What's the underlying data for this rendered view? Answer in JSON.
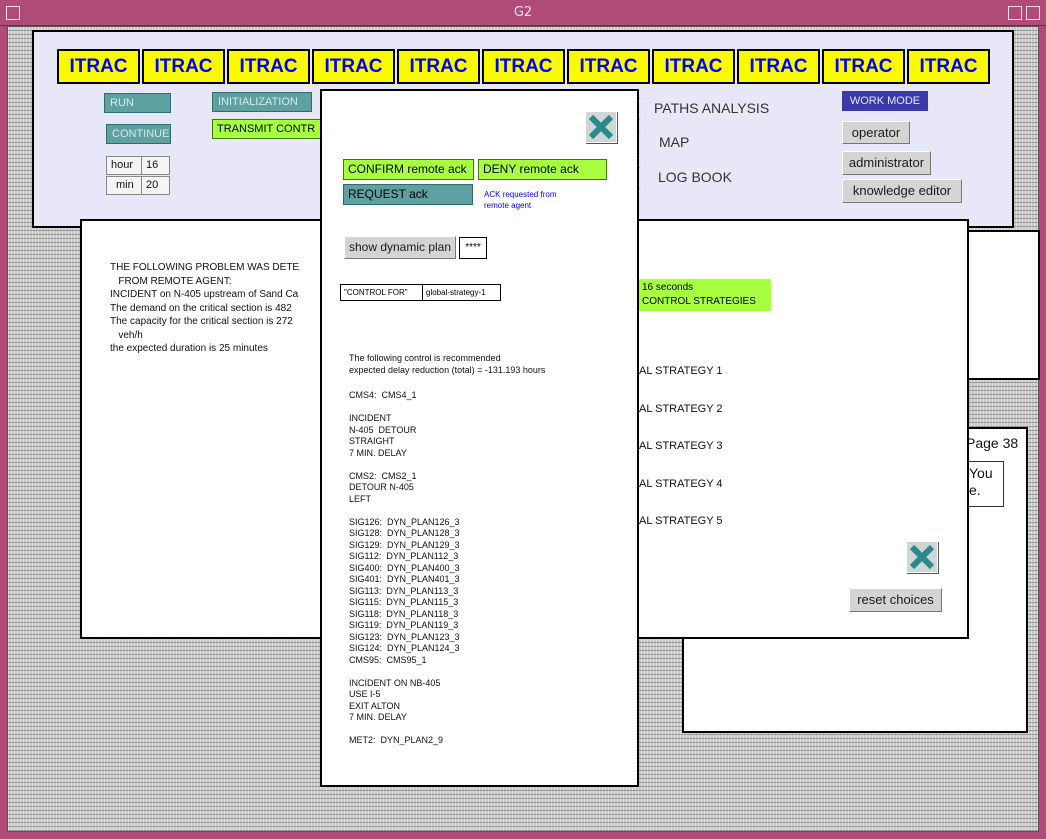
{
  "window": {
    "title": "G2"
  },
  "top_panel": {
    "itrac_buttons": [
      "ITRAC",
      "ITRAC",
      "ITRAC",
      "ITRAC",
      "ITRAC",
      "ITRAC",
      "ITRAC",
      "ITRAC",
      "ITRAC",
      "ITRAC",
      "ITRAC"
    ],
    "run_label": "RUN",
    "continue_label": "CONTINUE",
    "initialization_label": "INITIALIZATION",
    "transmit_label": "TRANSMIT CONTR",
    "hour_label": "hour",
    "hour_value": "16",
    "min_label": "min",
    "min_value": "20",
    "paths_analysis": "PATHS ANALYSIS",
    "map": "MAP",
    "log_book": "LOG BOOK",
    "work_mode": "WORK MODE",
    "operator": "operator",
    "administrator": "administrator",
    "knowledge_editor": "knowledge editor"
  },
  "problem_panel": {
    "lines": [
      "THE FOLLOWING PROBLEM WAS DETE",
      "   FROM REMOTE AGENT:",
      "INCIDENT on N-405 upstream of Sand Ca",
      "The demand on the critical section is 482",
      "The capacity for the critical section is 272",
      "   veh/h",
      "the expected duration is 25 minutes"
    ],
    "green_line1": "16 seconds",
    "green_line2": "CONTROL STRATEGIES",
    "strategies": [
      "AL STRATEGY 1",
      "AL STRATEGY 2",
      "AL STRATEGY 3",
      "AL STRATEGY 4",
      "AL STRATEGY 5"
    ],
    "reset_choices": "reset choices"
  },
  "page_panel": {
    "page_label": "Page 38",
    "text_line1": "You",
    "text_line2": "e."
  },
  "dialog": {
    "confirm": "CONFIRM remote ack",
    "deny": "DENY remote ack",
    "request": "REQUEST ack",
    "ack_note": "ACK requested from\nremote agent",
    "show_dynamic_plan": "show dynamic plan",
    "stars": "****",
    "control_for_label": "\"CONTROL FOR\"",
    "control_for_value": "global-strategy-1",
    "recommendation": "The following control is recommended\nexpected delay reduction (total) = -131.193 hours",
    "plan_text": "CMS4:  CMS4_1\n\nINCIDENT\nN-405  DETOUR\nSTRAIGHT\n7 MIN. DELAY\n\nCMS2:  CMS2_1\nDETOUR N-405\nLEFT\n\nSIG126:  DYN_PLAN126_3\nSIG128:  DYN_PLAN128_3\nSIG129:  DYN_PLAN129_3\nSIG112:  DYN_PLAN112_3\nSIG400:  DYN_PLAN400_3\nSIG401:  DYN_PLAN401_3\nSIG113:  DYN_PLAN113_3\nSIG115:  DYN_PLAN115_3\nSIG118:  DYN_PLAN118_3\nSIG119:  DYN_PLAN119_3\nSIG123:  DYN_PLAN123_3\nSIG124:  DYN_PLAN124_3\nCMS95:  CMS95_1\n\nINCIDENT ON NB-405\nUSE I-5\nEXIT ALTON\n7 MIN. DELAY\n\nMET2:  DYN_PLAN2_9"
  },
  "colors": {
    "accent_yellow": "#fafa00",
    "itrac_text": "#0000ff",
    "green": "#a8ff40",
    "teal": "#5fa0a0"
  },
  "icons": [
    "close-x-icon",
    "minimize-icon",
    "maximize-icon",
    "menu-icon"
  ]
}
